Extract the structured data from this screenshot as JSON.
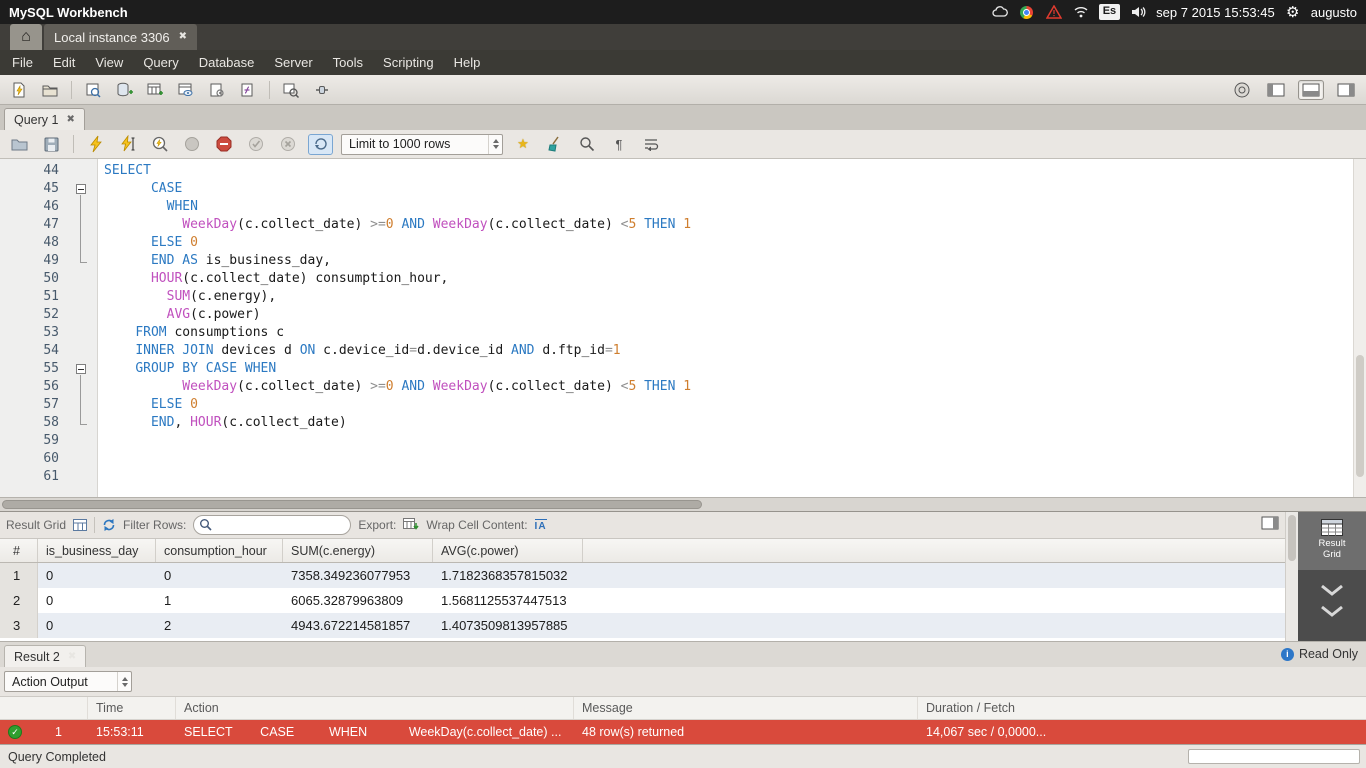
{
  "system_bar": {
    "app_title": "MySQL Workbench",
    "keyboard_indicator": "Es",
    "datetime": "sep 7 2015 15:53:45",
    "username": "augusto"
  },
  "window_tabs": {
    "instance_tab": "Local instance 3306"
  },
  "menu_items": [
    "File",
    "Edit",
    "View",
    "Query",
    "Database",
    "Server",
    "Tools",
    "Scripting",
    "Help"
  ],
  "query_tab_label": "Query 1",
  "editor_toolbar": {
    "limit_dropdown_value": "Limit to 1000 rows"
  },
  "sql": {
    "lines": [
      {
        "num": 44,
        "segs": [
          [
            "kw",
            "SELECT"
          ]
        ]
      },
      {
        "num": 45,
        "fold": "start",
        "segs": [
          [
            "pl",
            "      "
          ],
          [
            "kw",
            "CASE"
          ]
        ]
      },
      {
        "num": 46,
        "fold": "mid",
        "segs": [
          [
            "pl",
            "        "
          ],
          [
            "kw",
            "WHEN"
          ]
        ]
      },
      {
        "num": 47,
        "fold": "mid",
        "segs": [
          [
            "pl",
            "          "
          ],
          [
            "fn",
            "WeekDay"
          ],
          [
            "pl",
            "(c.collect_date) "
          ],
          [
            "op",
            ">="
          ],
          [
            "num",
            "0"
          ],
          [
            "pl",
            " "
          ],
          [
            "kw",
            "AND"
          ],
          [
            "pl",
            " "
          ],
          [
            "fn",
            "WeekDay"
          ],
          [
            "pl",
            "(c.collect_date) "
          ],
          [
            "op",
            "<"
          ],
          [
            "num",
            "5"
          ],
          [
            "pl",
            " "
          ],
          [
            "kw",
            "THEN"
          ],
          [
            "pl",
            " "
          ],
          [
            "num",
            "1"
          ]
        ]
      },
      {
        "num": 48,
        "fold": "mid",
        "segs": [
          [
            "pl",
            "      "
          ],
          [
            "kw",
            "ELSE"
          ],
          [
            "pl",
            " "
          ],
          [
            "num",
            "0"
          ]
        ]
      },
      {
        "num": 49,
        "fold": "end",
        "segs": [
          [
            "pl",
            "      "
          ],
          [
            "kw",
            "END"
          ],
          [
            "pl",
            " "
          ],
          [
            "kw",
            "AS"
          ],
          [
            "pl",
            " is_business_day,"
          ]
        ]
      },
      {
        "num": 50,
        "segs": [
          [
            "pl",
            "      "
          ],
          [
            "fn",
            "HOUR"
          ],
          [
            "pl",
            "(c.collect_date) consumption_hour,"
          ]
        ]
      },
      {
        "num": 51,
        "segs": [
          [
            "pl",
            "        "
          ],
          [
            "fn",
            "SUM"
          ],
          [
            "pl",
            "(c.energy),"
          ]
        ]
      },
      {
        "num": 52,
        "segs": [
          [
            "pl",
            "        "
          ],
          [
            "fn",
            "AVG"
          ],
          [
            "pl",
            "(c.power)"
          ]
        ]
      },
      {
        "num": 53,
        "segs": [
          [
            "pl",
            "    "
          ],
          [
            "kw",
            "FROM"
          ],
          [
            "pl",
            " consumptions c"
          ]
        ]
      },
      {
        "num": 54,
        "segs": [
          [
            "pl",
            "    "
          ],
          [
            "kw",
            "INNER JOIN"
          ],
          [
            "pl",
            " devices d "
          ],
          [
            "kw",
            "ON"
          ],
          [
            "pl",
            " c.device_id"
          ],
          [
            "op",
            "="
          ],
          [
            "pl",
            "d.device_id "
          ],
          [
            "kw",
            "AND"
          ],
          [
            "pl",
            " d.ftp_id"
          ],
          [
            "op",
            "="
          ],
          [
            "num",
            "1"
          ]
        ]
      },
      {
        "num": 55,
        "fold": "start",
        "segs": [
          [
            "pl",
            "    "
          ],
          [
            "kw",
            "GROUP BY CASE WHEN"
          ]
        ]
      },
      {
        "num": 56,
        "fold": "mid",
        "segs": [
          [
            "pl",
            "          "
          ],
          [
            "fn",
            "WeekDay"
          ],
          [
            "pl",
            "(c.collect_date) "
          ],
          [
            "op",
            ">="
          ],
          [
            "num",
            "0"
          ],
          [
            "pl",
            " "
          ],
          [
            "kw",
            "AND"
          ],
          [
            "pl",
            " "
          ],
          [
            "fn",
            "WeekDay"
          ],
          [
            "pl",
            "(c.collect_date) "
          ],
          [
            "op",
            "<"
          ],
          [
            "num",
            "5"
          ],
          [
            "pl",
            " "
          ],
          [
            "kw",
            "THEN"
          ],
          [
            "pl",
            " "
          ],
          [
            "num",
            "1"
          ]
        ]
      },
      {
        "num": 57,
        "fold": "mid",
        "segs": [
          [
            "pl",
            "      "
          ],
          [
            "kw",
            "ELSE"
          ],
          [
            "pl",
            " "
          ],
          [
            "num",
            "0"
          ]
        ]
      },
      {
        "num": 58,
        "fold": "end",
        "segs": [
          [
            "pl",
            "      "
          ],
          [
            "kw",
            "END"
          ],
          [
            "pl",
            ", "
          ],
          [
            "fn",
            "HOUR"
          ],
          [
            "pl",
            "(c.collect_date)"
          ]
        ]
      },
      {
        "num": 59,
        "segs": []
      },
      {
        "num": 60,
        "segs": []
      },
      {
        "num": 61,
        "segs": []
      }
    ]
  },
  "result_grid": {
    "panel_label": "Result Grid",
    "filter_label": "Filter Rows:",
    "filter_value": "",
    "export_label": "Export:",
    "wrap_label": "Wrap Cell Content:",
    "wrap_icon_text": "IA",
    "columns": [
      "#",
      "is_business_day",
      "consumption_hour",
      "SUM(c.energy)",
      "AVG(c.power)"
    ],
    "rows": [
      [
        "1",
        "0",
        "0",
        "7358.349236077953",
        "1.7182368357815032"
      ],
      [
        "2",
        "0",
        "1",
        "6065.32879963809",
        "1.5681125537447513"
      ],
      [
        "3",
        "0",
        "2",
        "4943.672214581857",
        "1.4073509813957885"
      ]
    ],
    "sidebar_button_label": "Result Grid"
  },
  "result_tab": {
    "label": "Result 2",
    "read_only": "Read Only"
  },
  "action_output": {
    "selector_value": "Action Output",
    "columns": [
      "Time",
      "Action",
      "Message",
      "Duration / Fetch"
    ],
    "row": {
      "index": "1",
      "time": "15:53:11",
      "action": "SELECT        CASE          WHEN            WeekDay(c.collect_date) ...",
      "message": "48 row(s) returned",
      "duration": "14,067 sec / 0,0000..."
    }
  },
  "status_bar": {
    "text": "Query Completed"
  },
  "icons": {
    "close": "✖",
    "home": "⌂",
    "gear": "⚙",
    "star": "★",
    "pilcrow": "¶",
    "check": "✓",
    "info": "i"
  },
  "colors": {
    "keyword_blue": "#2b79c2",
    "function_magenta": "#c050be",
    "number_orange": "#cf7e2e",
    "selected_row_red": "#d94a3c",
    "check_green": "#2f9e2f",
    "accent_blue": "#2d77c8"
  }
}
